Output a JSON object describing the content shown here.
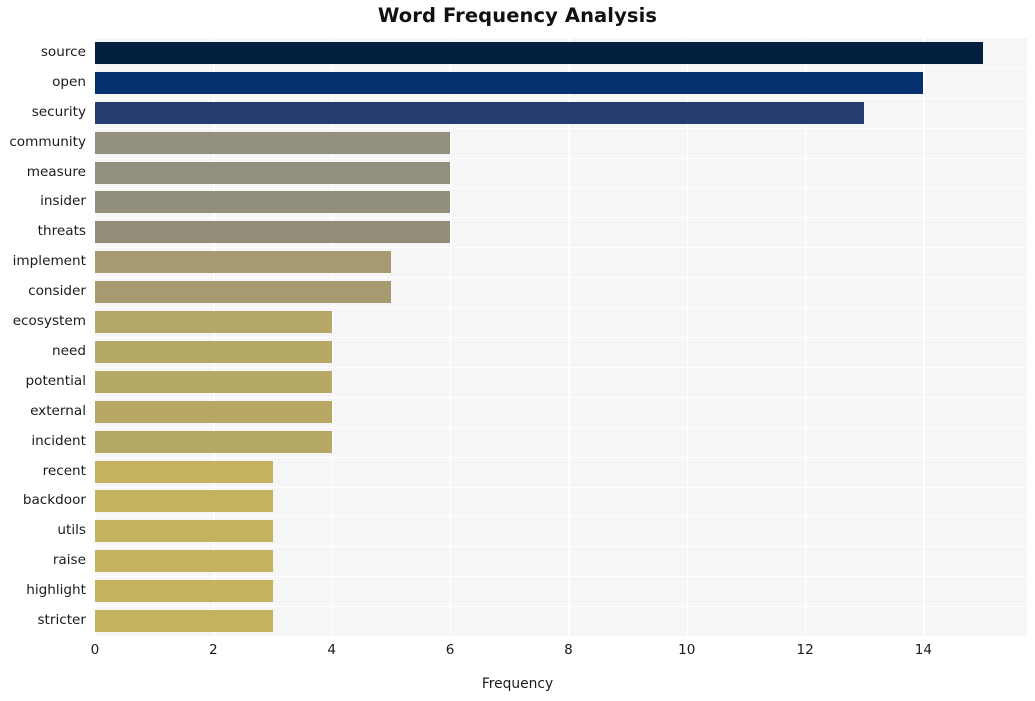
{
  "chart_data": {
    "type": "bar",
    "orientation": "horizontal",
    "title": "Word Frequency Analysis",
    "xlabel": "Frequency",
    "ylabel": "",
    "categories": [
      "source",
      "open",
      "security",
      "community",
      "measure",
      "insider",
      "threats",
      "implement",
      "consider",
      "ecosystem",
      "need",
      "potential",
      "external",
      "incident",
      "recent",
      "backdoor",
      "utils",
      "raise",
      "highlight",
      "stricter"
    ],
    "values": [
      15,
      14,
      13,
      6,
      6,
      6,
      6,
      5,
      5,
      4,
      4,
      4,
      4,
      4,
      3,
      3,
      3,
      3,
      3,
      3
    ],
    "xlim": [
      0,
      15.75
    ],
    "xticks": [
      "0",
      "2",
      "4",
      "6",
      "8",
      "10",
      "12",
      "14"
    ],
    "xtick_values": [
      0,
      2,
      4,
      6,
      8,
      10,
      12,
      14
    ],
    "grid": true,
    "grid_color": "#ffffff",
    "plot_background": "#f6f6f7",
    "legend": "none",
    "bar_colors": [
      "#04203f",
      "#04306e",
      "#243c6f",
      "#928f7c",
      "#928f7c",
      "#918e7b",
      "#918d79",
      "#a59a72",
      "#a59a71",
      "#b5a767",
      "#b5a766",
      "#b6a866",
      "#b6a765",
      "#b5a765",
      "#c4b261",
      "#c4b261",
      "#c4b260",
      "#c4b260",
      "#c4b25f",
      "#c5b25f"
    ]
  }
}
